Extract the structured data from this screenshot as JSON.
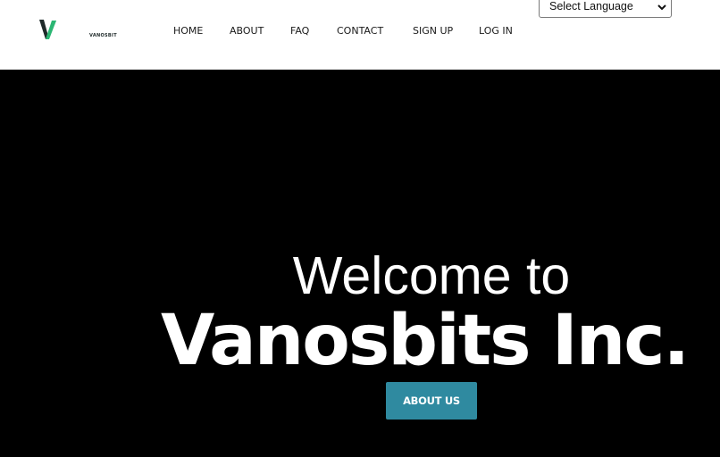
{
  "header": {
    "logo_text": "VANOSBIT",
    "nav": [
      "HOME",
      "ABOUT",
      "FAQ",
      "CONTACT",
      "SIGN UP",
      "LOG IN"
    ],
    "language_select": {
      "value": "Select Language"
    }
  },
  "hero": {
    "line1": "Welcome to",
    "line2": "Vanosbits Inc.",
    "button_label": "ABOUT US"
  },
  "colors": {
    "brand_green": "#2bb673",
    "brand_dark": "#1f2a2a",
    "button_teal": "#2f8aa0",
    "hero_bg": "#000000",
    "header_bg": "#ffffff"
  }
}
